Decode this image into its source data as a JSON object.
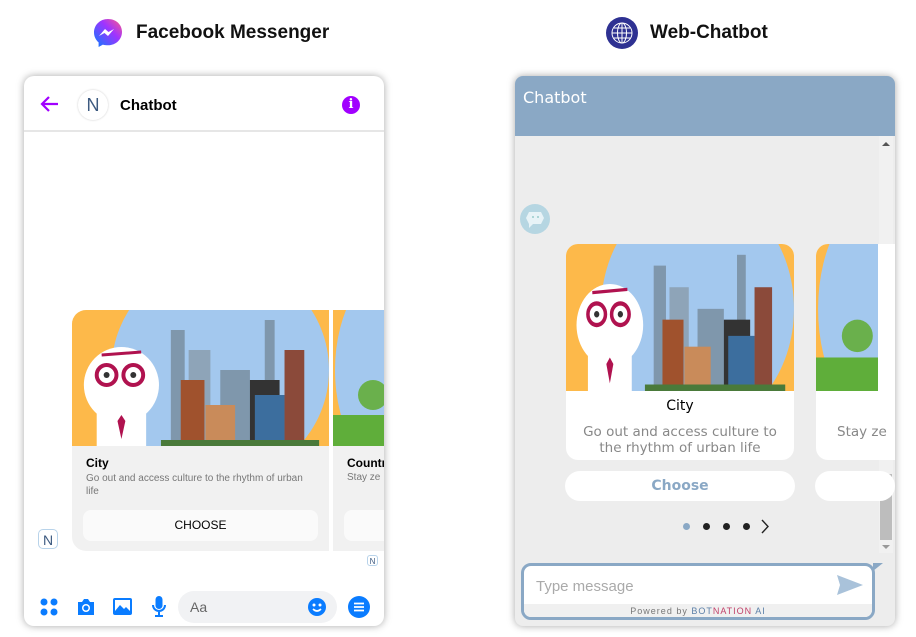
{
  "left": {
    "heading": "Facebook Messenger",
    "header": {
      "title": "Chatbot"
    },
    "cards": [
      {
        "title": "City",
        "description": "Go out and access culture to the rhythm of urban life",
        "button": "CHOOSE"
      },
      {
        "title": "Countr",
        "description": "Stay ze"
      }
    ],
    "composer": {
      "placeholder": "Aa"
    },
    "colors": {
      "accent": "#a100ff",
      "icons": "#0a7cff"
    }
  },
  "right": {
    "heading": "Web-Chatbot",
    "header": {
      "title": "Chatbot"
    },
    "cards": [
      {
        "title": "City",
        "description": "Go out and access culture to the rhythm of urban life",
        "button": "Choose"
      },
      {
        "description": "Stay ze"
      }
    ],
    "carousel": {
      "pages": 4,
      "active": 1
    },
    "composer": {
      "placeholder": "Type message"
    },
    "powered": {
      "prefix": "Powered by ",
      "bot": "BOT",
      "nation": "NATION",
      "ai": " AI"
    },
    "colors": {
      "header": "#8aa8c5",
      "body": "#ededed"
    }
  }
}
